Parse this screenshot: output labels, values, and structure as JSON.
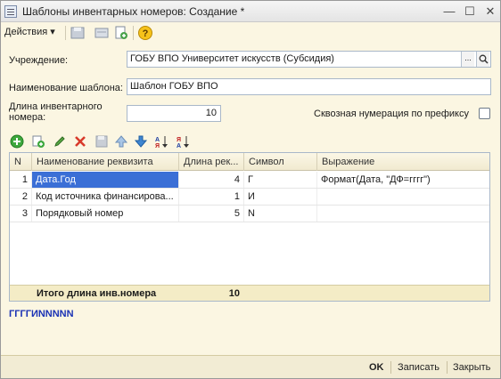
{
  "window": {
    "title": "Шаблоны инвентарных номеров: Создание *"
  },
  "toolbar": {
    "actions_label": "Действия",
    "icons": [
      "save-icon",
      "copy-icon",
      "new-document-icon",
      "help-icon"
    ]
  },
  "form": {
    "institution_label": "Учреждение:",
    "institution_value": "ГОБУ ВПО Университет искусств (Субсидия)",
    "template_name_label": "Наименование шаблона:",
    "template_name_value": "Шаблон ГОБУ ВПО",
    "length_label_line1": "Длина инвентарного",
    "length_label_line2": "номера:",
    "length_value": "10",
    "prefix_numbering_label": "Сквозная нумерация по префиксу",
    "prefix_numbering_checked": false
  },
  "grid_toolbar": {
    "icons": [
      "add-icon",
      "copy-row-icon",
      "edit-icon",
      "delete-icon",
      "end-edit-icon",
      "move-up-icon",
      "move-down-icon",
      "sort-asc-icon",
      "sort-desc-icon"
    ]
  },
  "table": {
    "columns": [
      "N",
      "Наименование реквизита",
      "Длина рек...",
      "Символ",
      "Выражение"
    ],
    "rows": [
      {
        "n": "1",
        "name": "Дата.Год",
        "length": "4",
        "symbol": "Г",
        "expression": "Формат(Дата, \"ДФ=гггг\")"
      },
      {
        "n": "2",
        "name": "Код источника финансирова...",
        "length": "1",
        "symbol": "И",
        "expression": ""
      },
      {
        "n": "3",
        "name": "Порядковый номер",
        "length": "5",
        "symbol": "N",
        "expression": ""
      }
    ],
    "footer_label": "Итого длина инв.номера",
    "footer_total": "10"
  },
  "preview_text": "ГГГГИNNNNN",
  "buttons": {
    "ok": "OK",
    "save": "Записать",
    "close": "Закрыть"
  },
  "colors": {
    "window_bg": "#fbf6e2",
    "selection": "#3b6fd6",
    "footer_bg": "#f4ecc6",
    "preview_text": "#1a32b5"
  }
}
